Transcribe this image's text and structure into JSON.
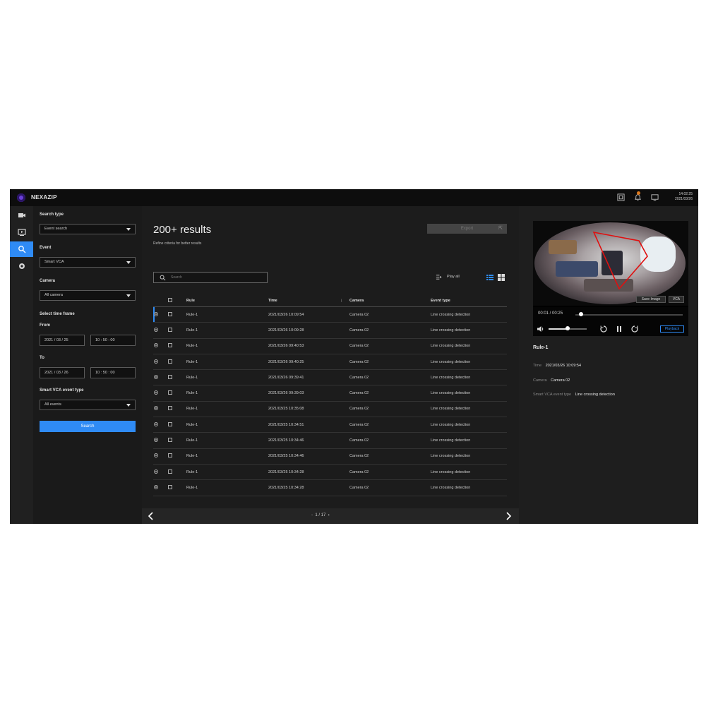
{
  "app": {
    "name": "NEXAZIP",
    "clock_time": "14:02:25",
    "clock_date": "2021/03/26"
  },
  "rail": {
    "items": [
      "camera-icon",
      "playback-icon",
      "search-icon",
      "settings-icon"
    ],
    "active": "search-icon"
  },
  "filters": {
    "search_type_label": "Search type",
    "search_type_value": "Event search",
    "event_label": "Event",
    "event_value": "Smart VCA",
    "camera_label": "Camera",
    "camera_value": "All camera",
    "time_frame_label": "Select time frame",
    "from_label": "From",
    "from_date": "2021 / 03 / 25",
    "from_time": "10 : 50 : 00",
    "to_label": "To",
    "to_date": "2021 / 03 / 26",
    "to_time": "10 : 50 : 00",
    "vca_type_label": "Smart VCA event type",
    "vca_type_value": "All events",
    "search_button": "Search"
  },
  "results": {
    "title": "200+ results",
    "subtitle": "Refine criteria for better results",
    "export_label": "Export",
    "search_placeholder": "Search",
    "play_all_label": "Play all",
    "columns": [
      "Rule",
      "Time",
      "Camera",
      "Event type"
    ],
    "rows": [
      {
        "rule": "Rule-1",
        "time": "2021/03/26 10:09:54",
        "camera": "Camera 02",
        "event": "Line crossing detection"
      },
      {
        "rule": "Rule-1",
        "time": "2021/03/26 10:09:28",
        "camera": "Camera 02",
        "event": "Line crossing detection"
      },
      {
        "rule": "Rule-1",
        "time": "2021/03/26 09:40:53",
        "camera": "Camera 02",
        "event": "Line crossing detection"
      },
      {
        "rule": "Rule-1",
        "time": "2021/03/26 09:40:25",
        "camera": "Camera 02",
        "event": "Line crossing detection"
      },
      {
        "rule": "Rule-1",
        "time": "2021/03/26 09:39:41",
        "camera": "Camera 02",
        "event": "Line crossing detection"
      },
      {
        "rule": "Rule-1",
        "time": "2021/03/26 09:39:03",
        "camera": "Camera 02",
        "event": "Line crossing detection"
      },
      {
        "rule": "Rule-1",
        "time": "2021/03/25 10:35:08",
        "camera": "Camera 02",
        "event": "Line crossing detection"
      },
      {
        "rule": "Rule-1",
        "time": "2021/03/25 10:34:51",
        "camera": "Camera 02",
        "event": "Line crossing detection"
      },
      {
        "rule": "Rule-1",
        "time": "2021/03/25 10:34:46",
        "camera": "Camera 02",
        "event": "Line crossing detection"
      },
      {
        "rule": "Rule-1",
        "time": "2021/03/25 10:34:46",
        "camera": "Camera 02",
        "event": "Line crossing detection"
      },
      {
        "rule": "Rule-1",
        "time": "2021/03/25 10:34:28",
        "camera": "Camera 02",
        "event": "Line crossing detection"
      },
      {
        "rule": "Rule-1",
        "time": "2021/03/25 10:34:28",
        "camera": "Camera 02",
        "event": "Line crossing detection"
      }
    ],
    "page_current": "1",
    "page_total": "17"
  },
  "detail": {
    "time_readout": "00:01 / 00:25",
    "playback_progress": 0.05,
    "volume_level": 0.5,
    "snapshot_label": "Save Image",
    "vca_label": "VCA",
    "playback_label": "Playback",
    "rule_name": "Rule-1",
    "time_label": "Time",
    "time_value": "2021/03/26 10:09:54",
    "camera_label": "Camera",
    "camera_value": "Camera 02",
    "event_type_label": "Smart VCA event type",
    "event_type_value": "Line crossing detection"
  },
  "colors": {
    "accent": "#2f8bf5",
    "logo": "#6a3fd8",
    "notification": "#e07b1f",
    "detection_zone": "#e01010"
  }
}
